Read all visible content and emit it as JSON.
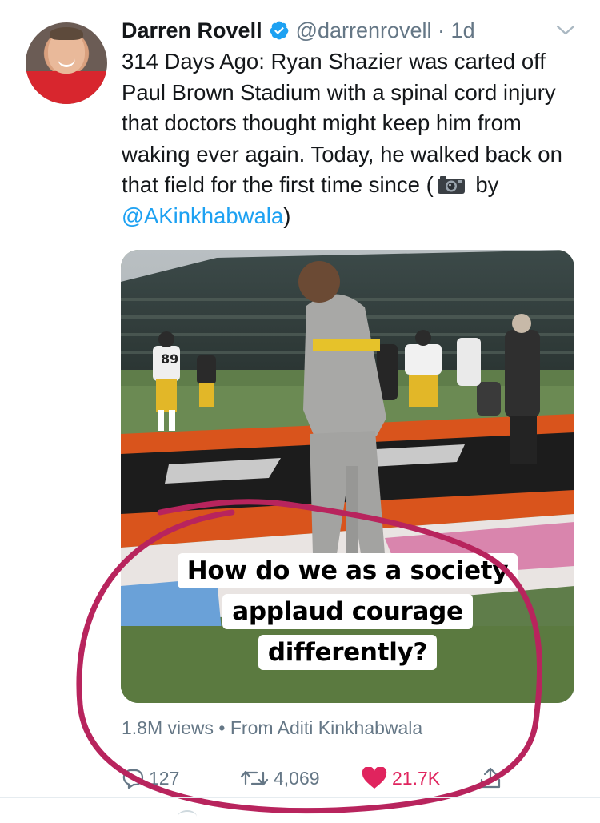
{
  "tweet": {
    "author_name": "Darren Rovell",
    "handle_time": "@darrenrovell · 1d",
    "text_before": "314 Days Ago: Ryan Shazier was carted off Paul Brown Stadium with a spinal cord injury that doctors thought might keep him from waking ever again. Today, he walked back on that field for the first time since (",
    "text_by": " by ",
    "mention": "@AKinkhabwala",
    "text_after": ")"
  },
  "media": {
    "jersey_number": "89",
    "caption_lines": [
      "How do we as a society",
      "applaud courage",
      "differently?"
    ]
  },
  "meta": {
    "views_source": "1.8M views • From Aditi Kinkhabwala"
  },
  "actions": {
    "replies": "127",
    "retweets": "4,069",
    "likes": "21.7K"
  },
  "icons": [
    "verified-badge-icon",
    "chevron-down-icon",
    "camera-icon",
    "reply-icon",
    "retweet-icon",
    "heart-icon",
    "share-icon"
  ],
  "colors": {
    "link": "#1da1f2",
    "verified": "#1da1f2",
    "like": "#e0245e",
    "secondary_text": "#657786",
    "annotation_circle": "#b8245d"
  }
}
